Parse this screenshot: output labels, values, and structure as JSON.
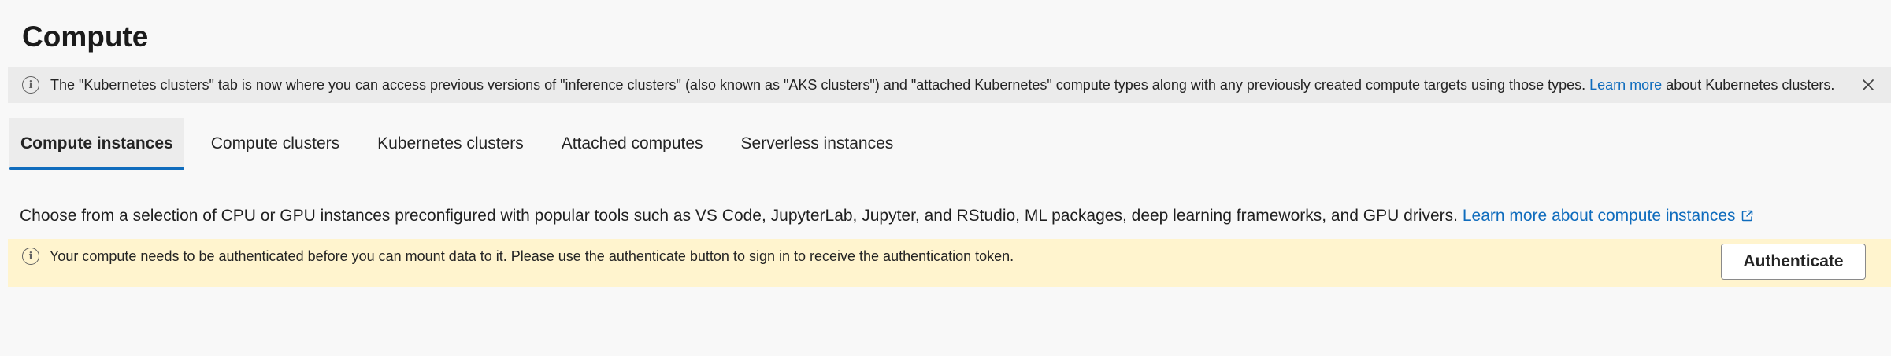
{
  "page": {
    "title": "Compute"
  },
  "notice": {
    "icon": "info-icon",
    "text": "The \"Kubernetes clusters\" tab is now where you can access previous versions of \"inference clusters\" (also known as \"AKS clusters\") and \"attached Kubernetes\" compute types along with any previously created compute targets using those types.",
    "link_text": "Learn more",
    "suffix": "about Kubernetes clusters.",
    "close_icon": "close-icon"
  },
  "tabs": [
    {
      "label": "Compute instances",
      "active": true
    },
    {
      "label": "Compute clusters",
      "active": false
    },
    {
      "label": "Kubernetes clusters",
      "active": false
    },
    {
      "label": "Attached computes",
      "active": false
    },
    {
      "label": "Serverless instances",
      "active": false
    }
  ],
  "description": {
    "text": "Choose from a selection of CPU or GPU instances preconfigured with popular tools such as VS Code, JupyterLab, Jupyter, and RStudio, ML packages, deep learning frameworks, and GPU drivers.",
    "link_text": "Learn more about compute instances",
    "link_icon": "external-link-icon"
  },
  "auth_warning": {
    "icon": "info-icon",
    "text": "Your compute needs to be authenticated before you can mount data to it. Please use the authenticate button to sign in to receive the authentication token.",
    "button_label": "Authenticate"
  },
  "colors": {
    "accent": "#0f6cbd",
    "notice_bg": "#ebebeb",
    "warning_bg": "#fff4ce",
    "page_bg": "#f8f8f8"
  }
}
